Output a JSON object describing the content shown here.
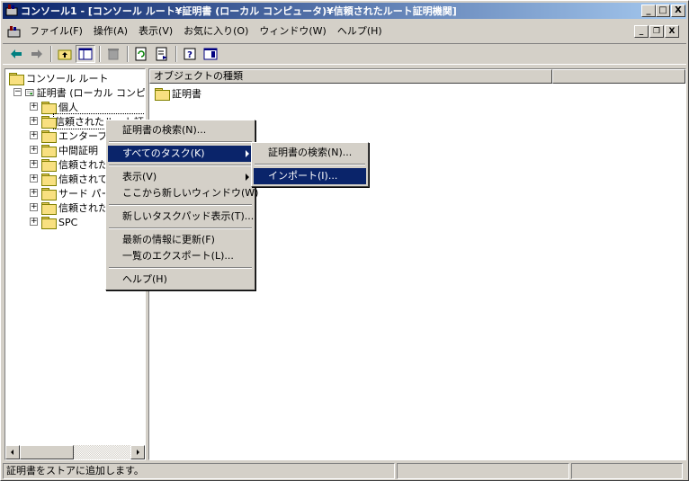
{
  "window": {
    "title": "コンソール1 - [コンソール ルート¥証明書 (ローカル コンピュータ)¥信頼されたルート証明機関]",
    "minimize": "_",
    "maximize": "□",
    "close": "X"
  },
  "menubar": {
    "items": [
      "ファイル(F)",
      "操作(A)",
      "表示(V)",
      "お気に入り(O)",
      "ウィンドウ(W)",
      "ヘルプ(H)"
    ]
  },
  "tree": {
    "root": "コンソール ルート",
    "cert": "証明書 (ローカル コンピ",
    "items": [
      "個人",
      "信頼されたルート証",
      "エンタープライ",
      "中間証明",
      "信頼された",
      "信頼されて",
      "サード パー",
      "信頼された",
      "SPC"
    ]
  },
  "list": {
    "column_header": "オブジェクトの種類",
    "item": "証明書"
  },
  "context_menu": {
    "items": [
      "証明書の検索(N)...",
      "すべてのタスク(K)",
      "表示(V)",
      "ここから新しいウィンドウ(W)",
      "新しいタスクパッド表示(T)...",
      "最新の情報に更新(F)",
      "一覧のエクスポート(L)...",
      "ヘルプ(H)"
    ]
  },
  "submenu": {
    "items": [
      "証明書の検索(N)...",
      "インポート(I)..."
    ]
  },
  "statusbar": {
    "text": "証明書をストアに追加します。"
  }
}
